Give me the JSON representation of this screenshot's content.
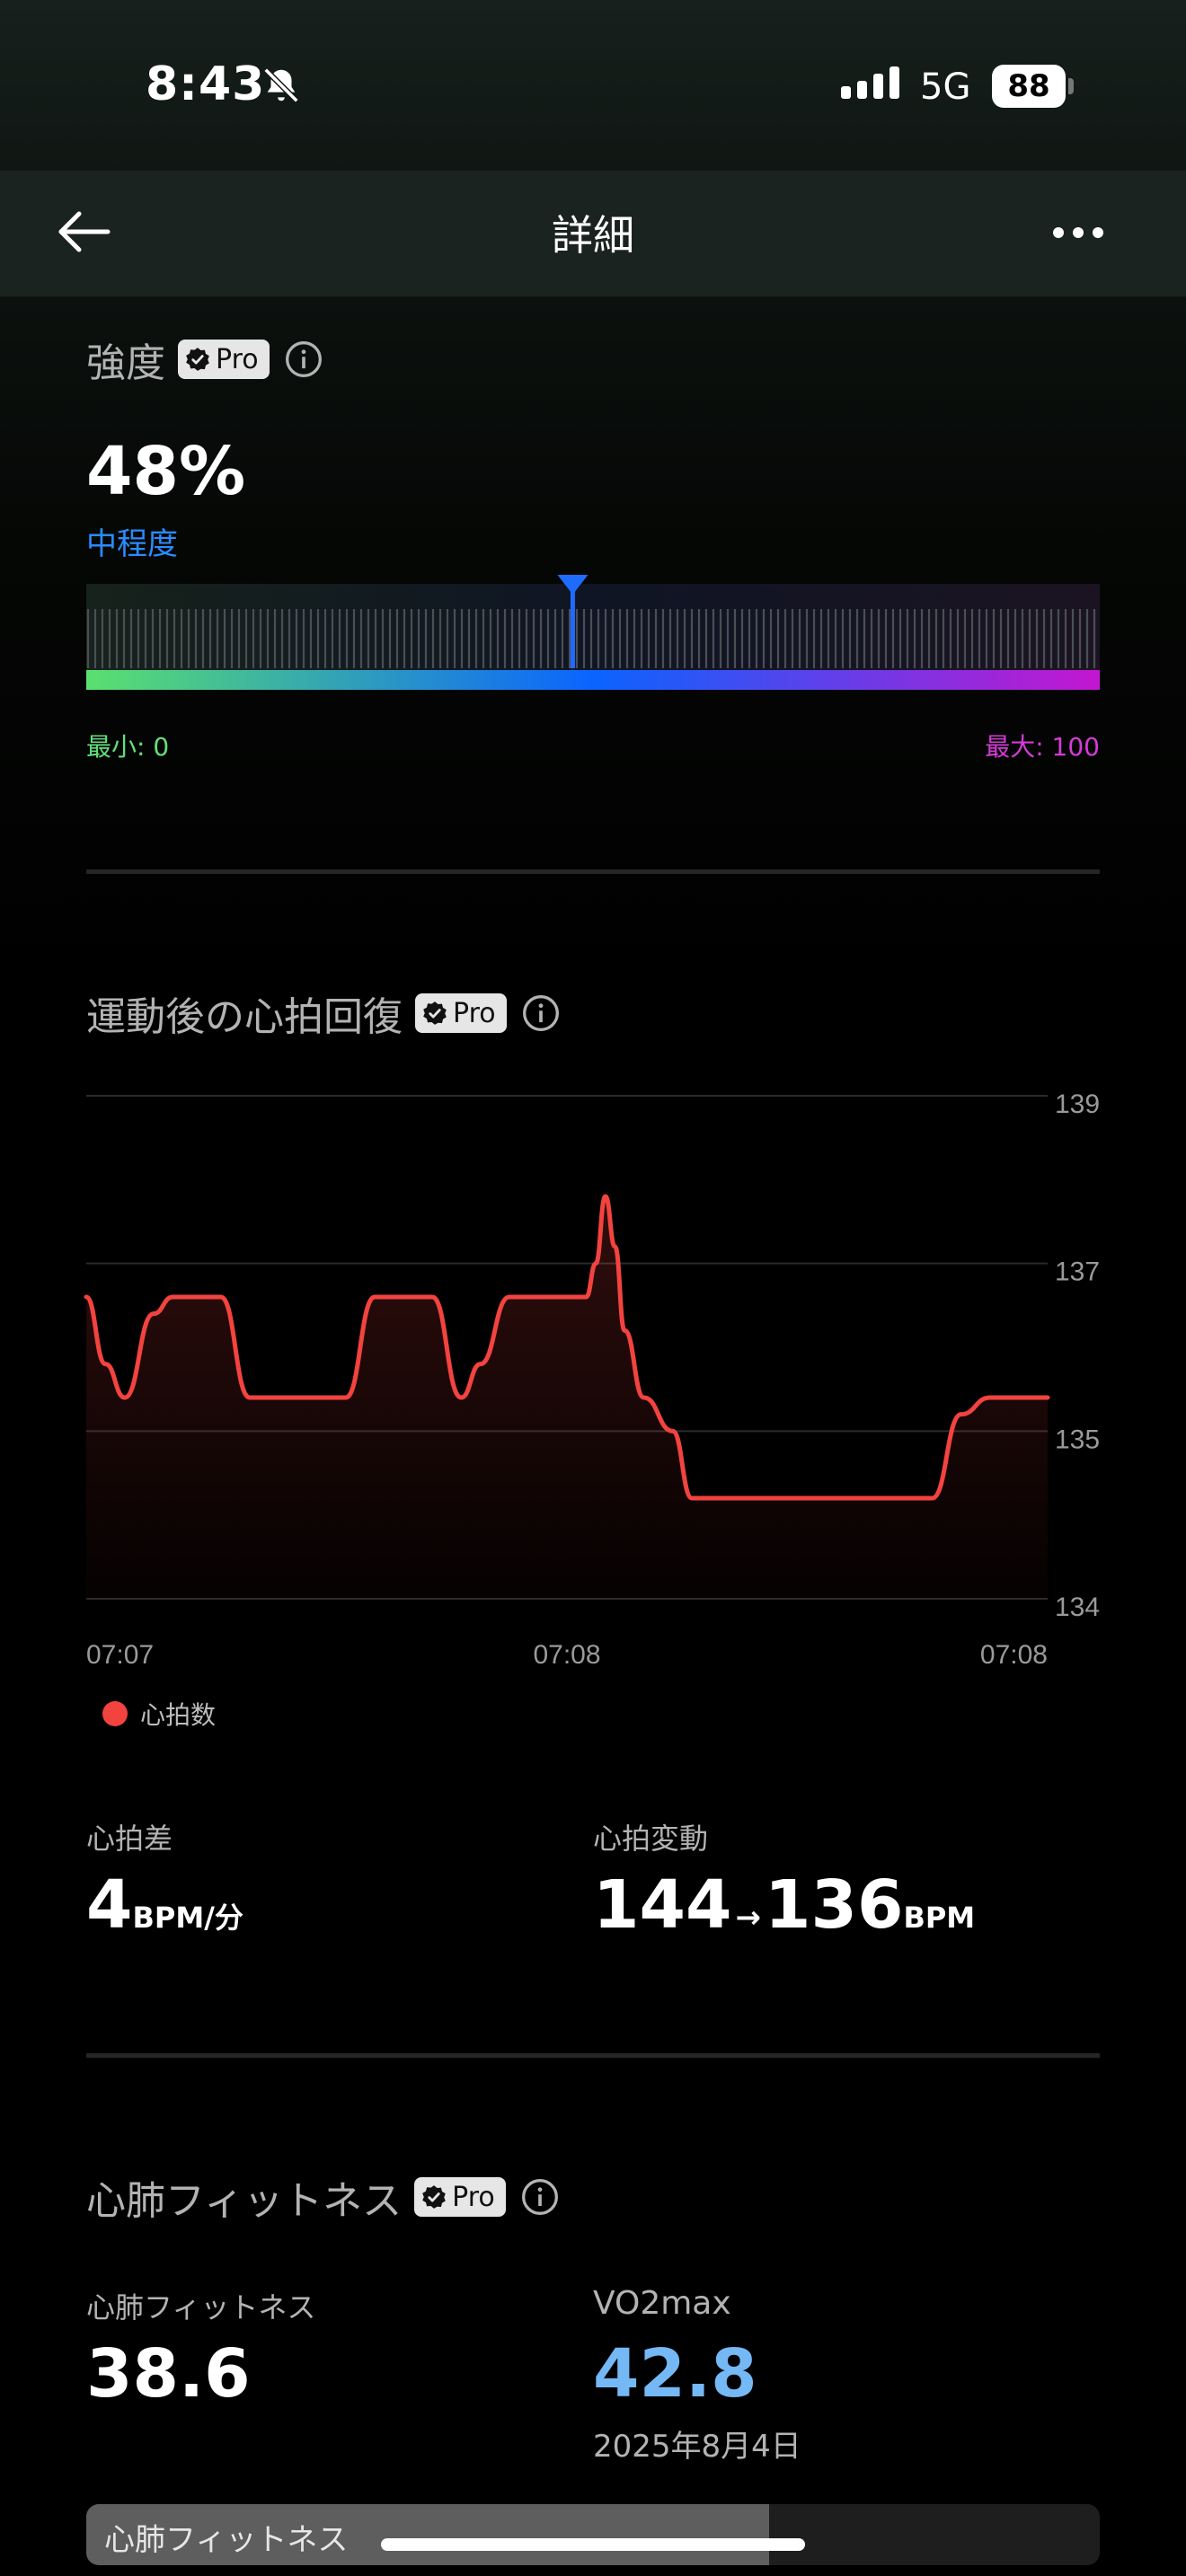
{
  "status_bar": {
    "time": "8:43",
    "network": "5G",
    "battery": "88"
  },
  "header": {
    "title": "詳細"
  },
  "badge": {
    "pro": "Pro"
  },
  "intensity": {
    "title": "強度",
    "value": "48%",
    "level": "中程度",
    "min_label": "最小: 0",
    "max_label": "最大: 100",
    "marker_percent": 48
  },
  "recovery": {
    "title": "運動後の心拍回復",
    "legend": "心拍数",
    "diff_label": "心拍差",
    "diff_value": "4",
    "diff_unit": "BPM/分",
    "change_label": "心拍変動",
    "change_from": "144",
    "change_arrow": "→",
    "change_to": "136",
    "change_unit": "BPM"
  },
  "chart_data": {
    "type": "line",
    "title": "",
    "xlabel": "",
    "ylabel": "",
    "x_ticks": [
      "07:07",
      "07:08",
      "07:08"
    ],
    "y_ticks": [
      139,
      137,
      135,
      134
    ],
    "y_tick_values": [
      136.5,
      135.5,
      134.5,
      133.5
    ],
    "ylim": [
      133.5,
      136.5
    ],
    "y_axis_position": "right",
    "grid": true,
    "legend_position": "bottom-left",
    "series": [
      {
        "name": "心拍数",
        "color": "#f2433f",
        "x": [
          0,
          0.02,
          0.04,
          0.07,
          0.09,
          0.14,
          0.17,
          0.27,
          0.3,
          0.36,
          0.39,
          0.41,
          0.44,
          0.5,
          0.52,
          0.53,
          0.54,
          0.55,
          0.56,
          0.58,
          0.61,
          0.63,
          0.66,
          0.73,
          0.88,
          0.91,
          0.94,
          1.0
        ],
        "y": [
          135.3,
          134.9,
          134.7,
          135.2,
          135.3,
          135.3,
          134.7,
          134.7,
          135.3,
          135.3,
          134.7,
          134.9,
          135.3,
          135.3,
          135.3,
          135.5,
          135.9,
          135.6,
          135.1,
          134.7,
          134.5,
          134.1,
          134.1,
          134.1,
          134.1,
          134.6,
          134.7,
          134.7
        ]
      }
    ]
  },
  "fitness": {
    "title": "心肺フィットネス",
    "label": "心肺フィットネス",
    "value": "38.6",
    "vo2_label": "VO2max",
    "vo2_value": "42.8",
    "vo2_date": "2025年8月4日",
    "bar_label": "心肺フィットネス",
    "bar_fraction": 0.674
  }
}
